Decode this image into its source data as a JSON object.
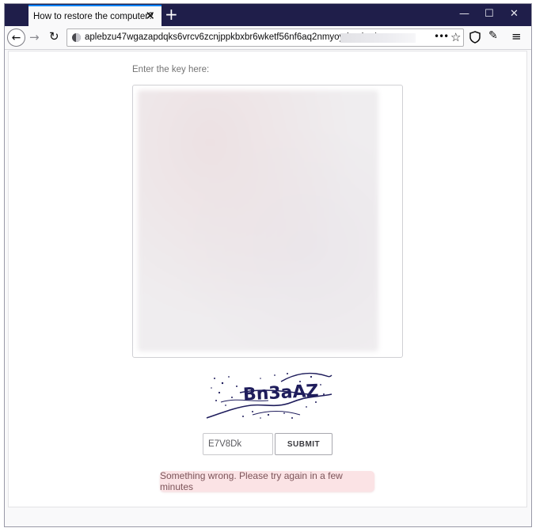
{
  "browser": {
    "tab_title": "How to restore the computer?",
    "tab_close": "✕",
    "new_tab": "+",
    "window_controls": {
      "minimize": "—",
      "maximize": "☐",
      "close": "✕"
    },
    "nav": {
      "back": "←",
      "forward": "→",
      "reload": "↻"
    },
    "url": "aplebzu47wgazapdqks6vrcv6zcnjppkbxbr6wketf56nf6aq2nmyoyd.onion/",
    "url_actions": {
      "more": "•••",
      "bookmark": "☆"
    },
    "toolbar": {
      "shield_icon": "shield-icon",
      "customize": "✎",
      "menu": "≡"
    }
  },
  "form": {
    "key_label": "Enter the key here:",
    "captcha_text": "Bn3aAZ",
    "captcha_input_value": "E7V8Dk",
    "submit_label": "SUBMIT",
    "error_message": "Something wrong. Please try again in a few minutes"
  },
  "colors": {
    "titlebar": "#1f1e4a",
    "active_tab_accent": "#0a84ff",
    "error_bg": "#fbe3e5",
    "error_text": "#7c5459",
    "captcha_ink": "#1f1d5c"
  }
}
